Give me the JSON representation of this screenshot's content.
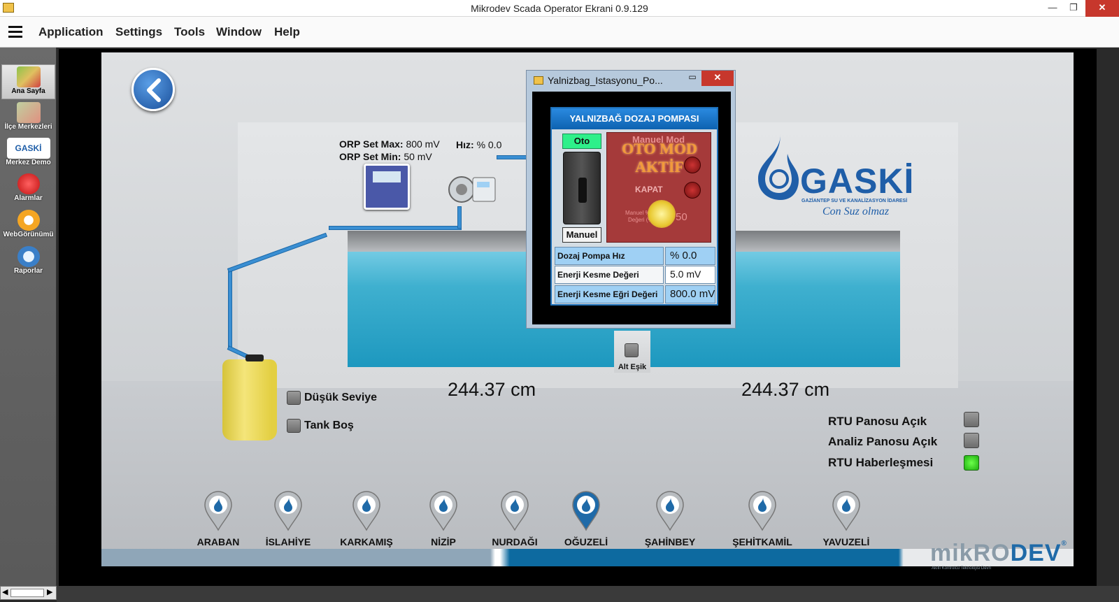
{
  "window": {
    "title": "Mikrodev Scada Operator Ekrani 0.9.129"
  },
  "menu": [
    "Application",
    "Settings",
    "Tools",
    "Window",
    "Help"
  ],
  "sidebar": {
    "items": [
      {
        "label": "Ana Sayfa",
        "icon": "map-icon",
        "active": true
      },
      {
        "label": "İlçe Merkezleri",
        "icon": "district-map-icon"
      },
      {
        "label": "Merkez Demo",
        "icon": "gaski-logo-icon"
      },
      {
        "label": "Alarmlar",
        "icon": "alarm-siren-icon"
      },
      {
        "label": "WebGörünümü",
        "icon": "cloud-icon"
      },
      {
        "label": "Raporlar",
        "icon": "report-icon"
      }
    ]
  },
  "station": {
    "orp_set_max_label": "ORP Set Max:",
    "orp_set_max_value": "800 mV",
    "orp_set_min_label": "ORP Set Min:",
    "orp_set_min_value": "50 mV",
    "hiz_label": "Hız:",
    "hiz_value": "% 0.0",
    "level_left": "244.37 cm",
    "level_right": "244.37 cm",
    "alt_esik": "Alt Eşik",
    "dusuk_seviye": "Düşük Seviye",
    "tank_bos": "Tank Boş",
    "rtu_panosu": "RTU Panosu Açık",
    "analiz_panosu": "Analiz Panosu Açık",
    "rtu_haberlesme": "RTU Haberleşmesi"
  },
  "gaski": {
    "name": "GASKİ",
    "subtitle": "GAZİANTEP SU VE KANALİZASYON İDARESİ",
    "slogan": "Con Suz olmaz"
  },
  "mikrodev": {
    "brand_a": "mikRO",
    "brand_b": "DEV",
    "reg": "®",
    "tagline": "Akıllı Kontrolcü Teknolojisi Devri"
  },
  "districts": [
    "ARABAN",
    "İSLAHİYE",
    "KARKAMIŞ",
    "NİZİP",
    "NURDAĞI",
    "OĞUZELİ",
    "ŞAHİNBEY",
    "ŞEHİTKAMİL",
    "YAVUZELİ"
  ],
  "popup": {
    "title": "Yalnizbag_Istasyonu_Po...",
    "header": "YALNIZBAĞ DOZAJ POMPASI",
    "oto": "Oto",
    "manuel": "Manuel",
    "manuel_mod": "Manuel Mod",
    "oto_mod_1": "OTO MOD",
    "oto_mod_2": "AKTİF",
    "kapat": "KAPAT",
    "manuel_degeri": "Manuel %",
    "manuel_degeri_2": "Değeri (%)",
    "manuel_value": "50",
    "rows": [
      {
        "label": "Dozaj Pompa Hız",
        "value": "% 0.0"
      },
      {
        "label": "Enerji Kesme Değeri",
        "value": "5.0 mV"
      },
      {
        "label": "Enerji Kesme Eğri Değeri",
        "value": "800.0 mV"
      }
    ]
  },
  "colors": {
    "accent": "#1f5ea8",
    "water": "#3fb0cf",
    "ok": "#1fb010",
    "close": "#c7372c"
  }
}
